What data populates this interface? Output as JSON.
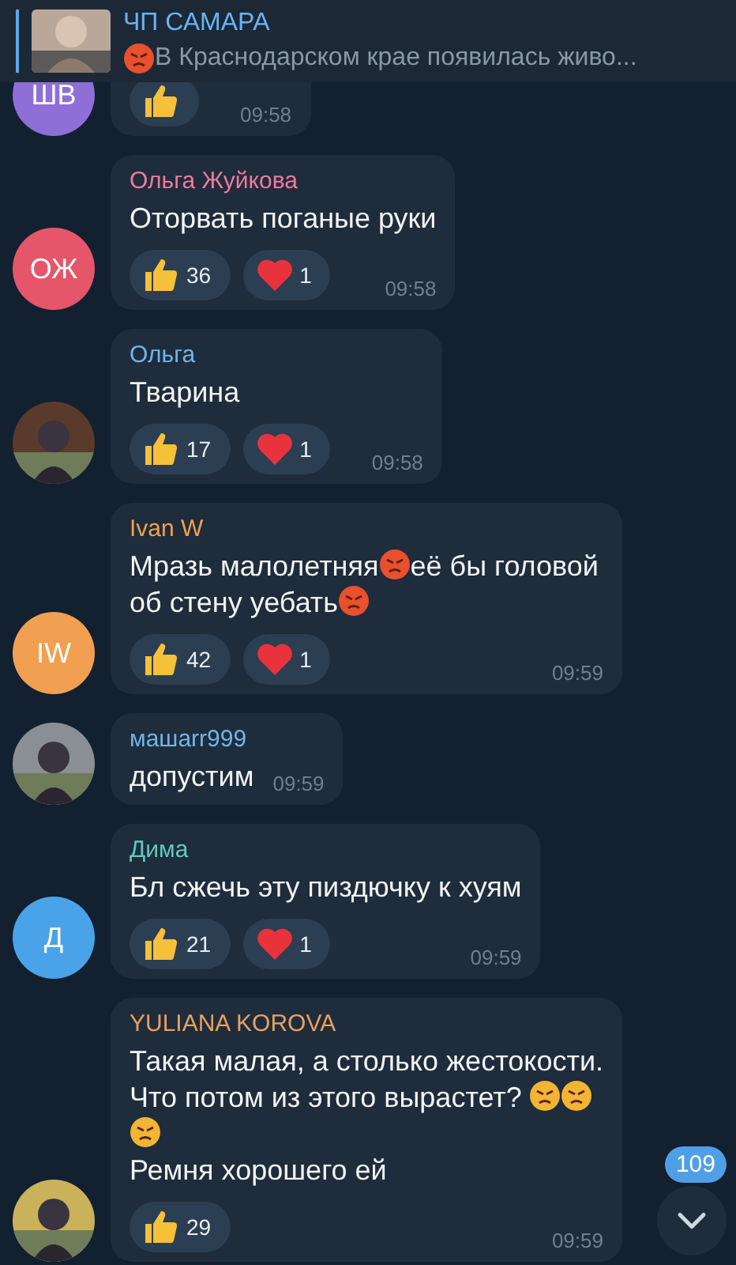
{
  "pinned": {
    "title": "ЧП САМАРА",
    "preview": [
      {
        "kind": "rage"
      },
      {
        "kind": "text",
        "text": "В Краснодарском крае появилась живо..."
      }
    ],
    "thumbnail": {
      "kind": "picture"
    }
  },
  "messages": [
    {
      "avatar": {
        "kind": "initials",
        "initials": "ШВ",
        "color": "#8e6fd8"
      },
      "reactions": [
        {
          "kind": "like"
        }
      ],
      "time": "09:58"
    },
    {
      "author": "Ольга Жуйкова",
      "color": "#ee7aa0",
      "avatar": {
        "kind": "initials",
        "initials": "ОЖ",
        "color": "#e5566b"
      },
      "text": [
        {
          "kind": "text",
          "text": "Оторвать поганые руки"
        }
      ],
      "reactions": [
        {
          "kind": "like",
          "count": "36"
        },
        {
          "kind": "heart",
          "count": "1"
        }
      ],
      "time": "09:58"
    },
    {
      "author": "Ольга",
      "color": "#72b4ea",
      "avatar": {
        "kind": "picture"
      },
      "text": [
        {
          "kind": "text",
          "text": "Тварина"
        }
      ],
      "reactions": [
        {
          "kind": "like",
          "count": "17"
        },
        {
          "kind": "heart",
          "count": "1"
        }
      ],
      "time": "09:58"
    },
    {
      "author": "Ivan W",
      "color": "#f0a050",
      "avatar": {
        "kind": "initials",
        "initials": "IW",
        "color": "#f0a050"
      },
      "text": [
        {
          "kind": "text",
          "text": "Мразь малолетняя"
        },
        {
          "kind": "rage"
        },
        {
          "kind": "text",
          "text": "её бы головой об стену уебать"
        },
        {
          "kind": "rage"
        }
      ],
      "reactions": [
        {
          "kind": "like",
          "count": "42"
        },
        {
          "kind": "heart",
          "count": "1"
        }
      ],
      "time": "09:59"
    },
    {
      "author": "машarr999",
      "color": "#72b4ea",
      "avatar": {
        "kind": "picture"
      },
      "text": [
        {
          "kind": "text",
          "text": "допустим"
        }
      ],
      "time": "09:59"
    },
    {
      "author": "Дима",
      "color": "#5fc9c2",
      "avatar": {
        "kind": "initials",
        "initials": "Д",
        "color": "#4aa3e8"
      },
      "text": [
        {
          "kind": "text",
          "text": "Бл сжечь эту пиздючку к хуям"
        }
      ],
      "reactions": [
        {
          "kind": "like",
          "count": "21"
        },
        {
          "kind": "heart",
          "count": "1"
        }
      ],
      "time": "09:59"
    },
    {
      "author": "YULIANA KOROVA",
      "color": "#e8a060",
      "avatar": {
        "kind": "picture"
      },
      "text": [
        {
          "kind": "text",
          "text": "Такая малая, а столько жестокости. Что потом из этого вырастет? "
        },
        {
          "kind": "angry"
        },
        {
          "kind": "angry"
        },
        {
          "kind": "angry"
        },
        {
          "kind": "break"
        },
        {
          "kind": "text",
          "text": "Ремня хорошего ей"
        }
      ],
      "reactions": [
        {
          "kind": "like",
          "count": "29"
        }
      ],
      "time": "09:59"
    }
  ],
  "unread_badge": "109"
}
